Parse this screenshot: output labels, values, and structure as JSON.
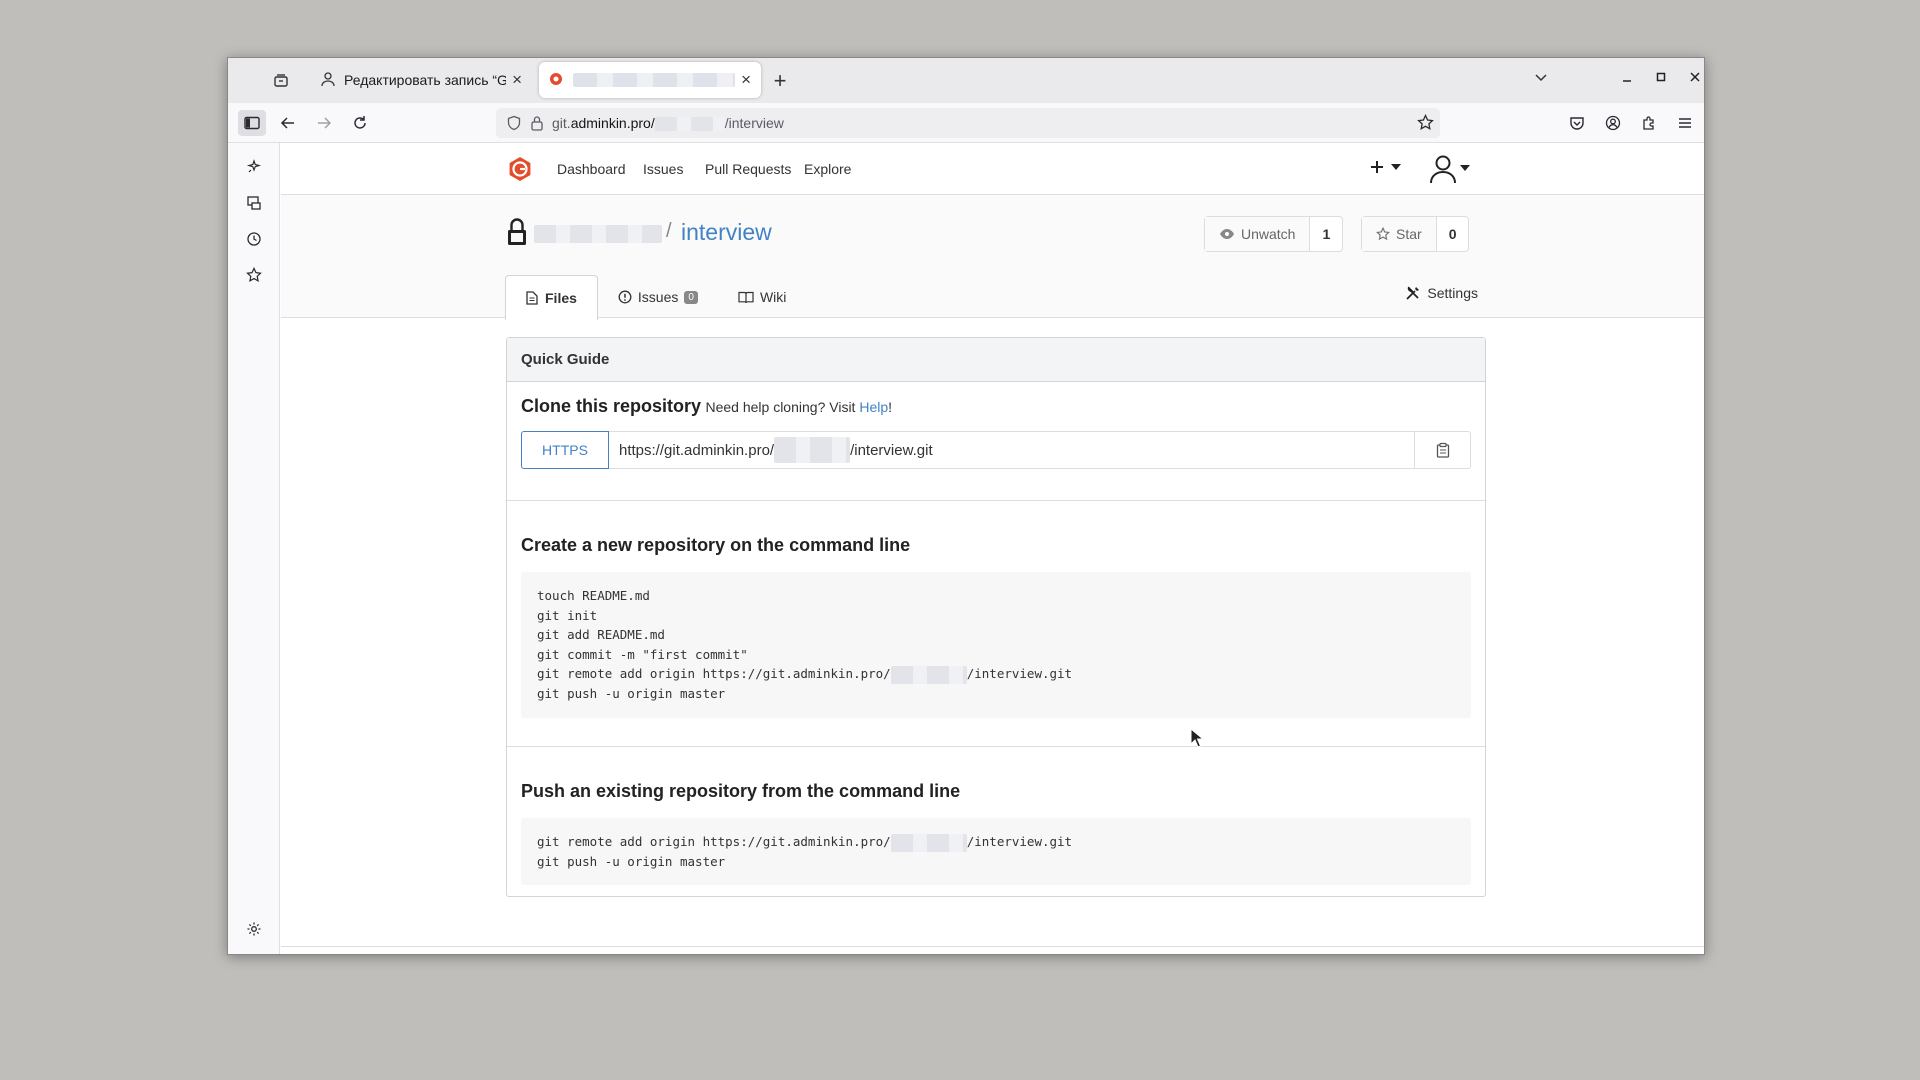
{
  "browser": {
    "tabs": [
      {
        "title": "Редактировать запись “Gi"
      },
      {
        "title": ""
      }
    ],
    "url_prefix": "git.",
    "url_domain": "adminkin.pro/",
    "url_suffix": "/interview"
  },
  "gitea": {
    "menu": [
      "Dashboard",
      "Issues",
      "Pull Requests",
      "Explore"
    ],
    "repo_sep": "/",
    "repo_name": "interview",
    "unwatch_label": "Unwatch",
    "unwatch_count": "1",
    "star_label": "Star",
    "star_count": "0",
    "tabs": {
      "files": "Files",
      "issues": "Issues",
      "issues_count": "0",
      "wiki": "Wiki",
      "settings": "Settings"
    }
  },
  "guide": {
    "header": "Quick Guide",
    "clone_title": "Clone this repository",
    "clone_help_text": "Need help cloning? Visit",
    "clone_help_link": "Help",
    "clone_help_end": "!",
    "https_label": "HTTPS",
    "clone_url_start": "https://git.adminkin.pro/",
    "clone_url_end": "/interview.git",
    "new_repo_title": "Create a new repository on the command line",
    "new_repo_lines": [
      "touch README.md",
      "git init",
      "git add README.md",
      "git commit -m \"first commit\"",
      "git remote add origin https://git.adminkin.pro/",
      "/interview.git",
      "git push -u origin master"
    ],
    "push_title": "Push an existing repository from the command line",
    "push_lines": [
      "git remote add origin https://git.adminkin.pro/",
      "/interview.git",
      "git push -u origin master"
    ]
  },
  "colors": {
    "link": "#4183c4",
    "logo": "#e24d2c"
  }
}
